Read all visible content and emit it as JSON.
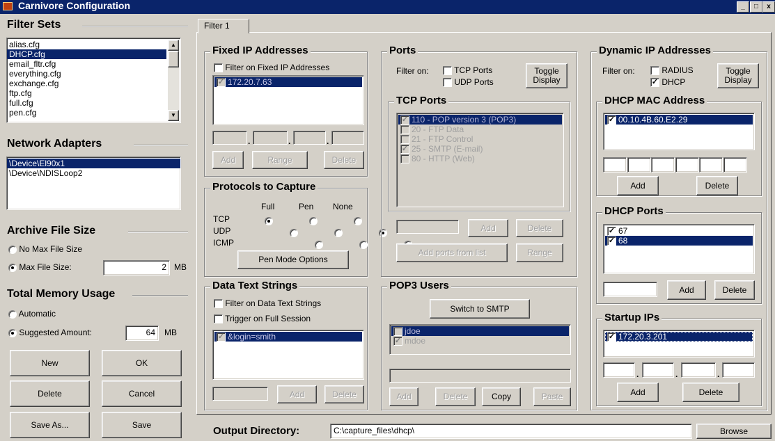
{
  "window": {
    "title": "Carnivore Configuration",
    "controls": [
      "_",
      "□",
      "x"
    ]
  },
  "filter_sets": {
    "title": "Filter Sets",
    "items": [
      "alias.cfg",
      "DHCP.cfg",
      "email_fltr.cfg",
      "everything.cfg",
      "exchange.cfg",
      "ftp.cfg",
      "full.cfg",
      "pen.cfg"
    ],
    "selected_index": 1
  },
  "network_adapters": {
    "title": "Network Adapters",
    "items": [
      "\\Device\\El90x1",
      "\\Device\\NDISLoop2"
    ],
    "selected_index": 0
  },
  "archive_file_size": {
    "title": "Archive File Size",
    "no_max_label": "No Max File Size",
    "max_label": "Max File Size:",
    "max_value": "2",
    "unit": "MB",
    "selected": "max"
  },
  "total_memory": {
    "title": "Total Memory Usage",
    "automatic_label": "Automatic",
    "suggested_label": "Suggested Amount:",
    "suggested_value": "64",
    "unit": "MB",
    "selected": "suggested"
  },
  "left_buttons": {
    "new": "New",
    "ok": "OK",
    "delete": "Delete",
    "cancel": "Cancel",
    "save_as": "Save As...",
    "save": "Save"
  },
  "tab": {
    "label": "Filter 1"
  },
  "fixed_ip": {
    "title": "Fixed IP Addresses",
    "filter_label": "Filter on Fixed IP Addresses",
    "filter_checked": false,
    "items": [
      {
        "label": "172.20.7.63",
        "checked": true
      }
    ],
    "add": "Add",
    "range": "Range",
    "delete": "Delete"
  },
  "protocols": {
    "title": "Protocols to Capture",
    "columns": [
      "Full",
      "Pen",
      "None"
    ],
    "rows": [
      {
        "name": "TCP",
        "selected": "Full"
      },
      {
        "name": "UDP",
        "selected": "None"
      },
      {
        "name": "ICMP",
        "selected": "None"
      }
    ],
    "pen_mode_button": "Pen Mode Options"
  },
  "data_text": {
    "title": "Data Text Strings",
    "filter_label": "Filter on Data Text Strings",
    "trigger_label": "Trigger on Full Session",
    "items": [
      {
        "label": "&login=smith",
        "checked": true
      }
    ],
    "add": "Add",
    "delete": "Delete"
  },
  "ports": {
    "title": "Ports",
    "filter_on": "Filter on:",
    "tcp_label": "TCP Ports",
    "udp_label": "UDP Ports",
    "toggle_display": [
      "Toggle",
      "Display"
    ],
    "tcp_title": "TCP Ports",
    "tcp_items": [
      {
        "label": "110 - POP version 3 (POP3)",
        "checked": true,
        "selected": true
      },
      {
        "label": "20 - FTP Data",
        "checked": false
      },
      {
        "label": "21 - FTP Control",
        "checked": false
      },
      {
        "label": "25 - SMTP (E-mail)",
        "checked": true
      },
      {
        "label": "80 - HTTP (Web)",
        "checked": false
      }
    ],
    "add": "Add",
    "delete": "Delete",
    "add_from_list": "Add ports from list",
    "range": "Range"
  },
  "pop3": {
    "title": "POP3 Users",
    "switch_button": "Switch to SMTP",
    "items": [
      {
        "label": "jdoe",
        "checked": false,
        "selected": true
      },
      {
        "label": "mdoe",
        "checked": true
      }
    ],
    "add": "Add",
    "delete": "Delete",
    "copy": "Copy",
    "paste": "Paste"
  },
  "dynamic_ip": {
    "title": "Dynamic IP Addresses",
    "filter_on": "Filter on:",
    "radius_label": "RADIUS",
    "dhcp_label": "DHCP",
    "dhcp_checked": true,
    "toggle_display": [
      "Toggle",
      "Display"
    ],
    "mac_title": "DHCP MAC Address",
    "mac_items": [
      {
        "label": "00.10.4B.60.E2.29",
        "checked": true
      }
    ],
    "mac_add": "Add",
    "mac_delete": "Delete",
    "ports_title": "DHCP Ports",
    "port_items": [
      {
        "label": "67",
        "checked": true,
        "selected": false
      },
      {
        "label": "68",
        "checked": true,
        "selected": true
      }
    ],
    "ports_add": "Add",
    "ports_delete": "Delete",
    "startup_title": "Startup IPs",
    "startup_items": [
      {
        "label": "172.20.3.201",
        "checked": true
      }
    ],
    "startup_add": "Add",
    "startup_delete": "Delete"
  },
  "output": {
    "label": "Output Directory:",
    "value": "C:\\capture_files\\dhcp\\",
    "browse": "Browse"
  }
}
